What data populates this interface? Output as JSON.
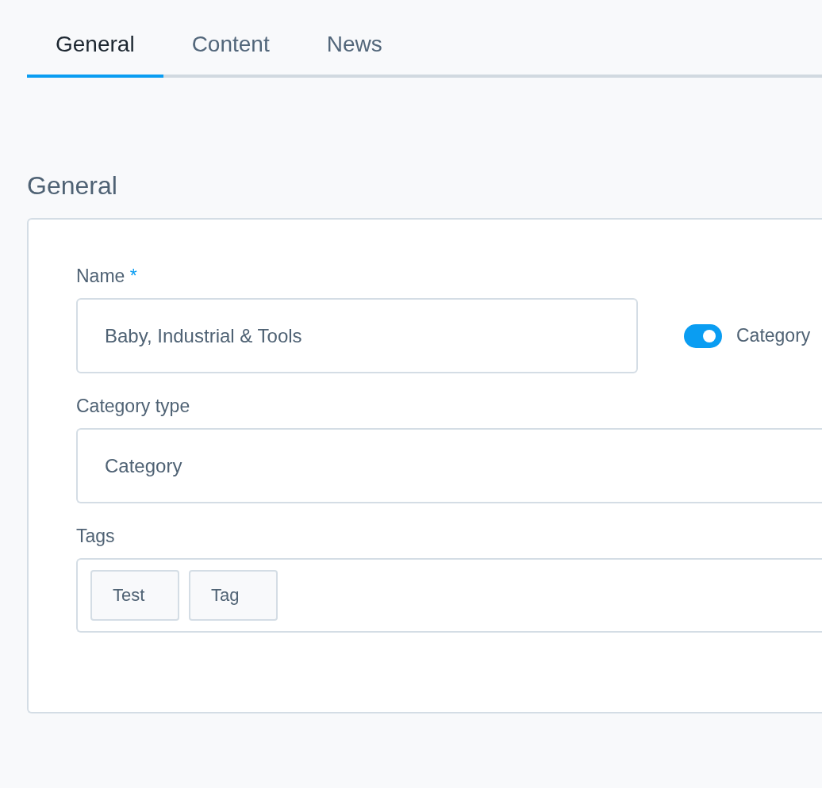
{
  "tabs": [
    {
      "label": "General",
      "selected": true
    },
    {
      "label": "Content",
      "selected": false
    },
    {
      "label": "News",
      "selected": false
    }
  ],
  "section": {
    "title": "General"
  },
  "form": {
    "name": {
      "label": "Name",
      "required_mark": "*",
      "value": "Baby, Industrial & Tools"
    },
    "toggle": {
      "label": "Category",
      "on": true
    },
    "category_type": {
      "label": "Category type",
      "value": "Category"
    },
    "tags": {
      "label": "Tags",
      "items": [
        "Test",
        "Tag"
      ]
    }
  }
}
